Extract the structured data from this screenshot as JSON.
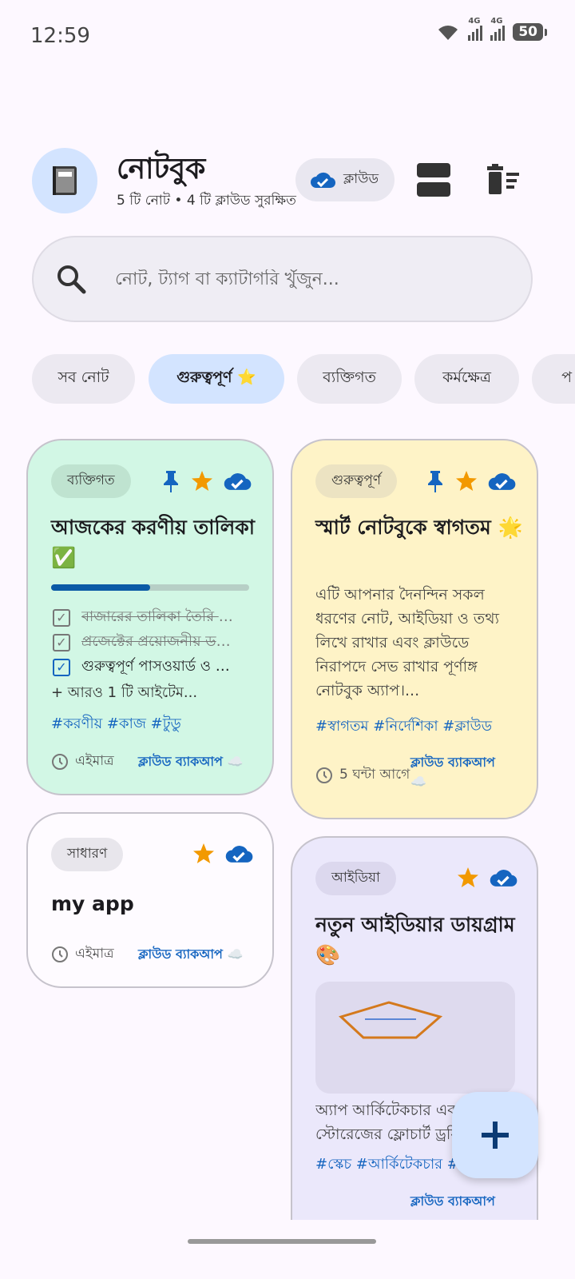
{
  "status": {
    "time": "12:59",
    "net1": "4G",
    "net2": "4G",
    "battery": "50"
  },
  "header": {
    "title": "নোটবুক",
    "subtitle": "5 টি নোট • 4 টি ক্লাউড সুরক্ষিত",
    "cloud_label": "ক্লাউড"
  },
  "search": {
    "placeholder": "নোট, ট্যাগ বা ক্যাটাগরি খুঁজুন..."
  },
  "filters": [
    "সব নোট",
    "গুরুত্বপূর্ণ ⭐",
    "ব্যক্তিগত",
    "কর্মক্ষেত্র",
    "প"
  ],
  "colors": {
    "accent": "#1565c0",
    "star": "#f29900",
    "green_card": "#d2f7e5",
    "yellow_card": "#fef3c7",
    "purple_card": "#ebe8fb"
  },
  "cards": {
    "todo": {
      "category": "ব্যক্তিগত",
      "title": "আজকের করণীয় তালিকা ✅",
      "progress": 0.5,
      "items": [
        "বাজারের তালিকা তৈরি করা",
        "প্রজেক্টের প্রয়োজনীয় ডকুমেন্ট",
        "গুরুত্বপূর্ণ পাসওয়ার্ড ও তথ্য"
      ],
      "more": "+ আরও 1 টি আইটেম...",
      "tags": "#করণীয়  #কাজ  #টুডু",
      "time": "এইমাত্র",
      "backup": "ক্লাউড ব্যাকআপ"
    },
    "welcome": {
      "category": "গুরুত্বপূর্ণ",
      "title": "স্মার্ট নোটবুকে স্বাগতম 🌟",
      "body": "এটি আপনার দৈনন্দিন সকল ধরণের নোট, আইডিয়া ও তথ্য লিখে রাখার এবং ক্লাউডে নিরাপদে সেভ রাখার পূর্ণাঙ্গ নোটবুক অ্যাপ।...",
      "tags": "#স্বাগতম  #নির্দেশিকা  #ক্লাউড",
      "time": "5 ঘন্টা আগে",
      "backup": "ক্লাউড ব্যাকআপ"
    },
    "myapp": {
      "category": "সাধারণ",
      "title": "my app",
      "time": "এইমাত্র",
      "backup": "ক্লাউড ব্যাকআপ"
    },
    "idea": {
      "category": "আইডিয়া",
      "title": "নতুন আইডিয়ার ডায়গ্রাম 🎨",
      "body": "অ্যাপ আর্কিটেকচার এবং স্টোরেজের ফ্লোচার্ট ড্রয়িং",
      "tags": "#স্কেচ  #আর্কিটেকচার  #",
      "backup": "ক্লাউড ব্যাকআপ"
    }
  }
}
